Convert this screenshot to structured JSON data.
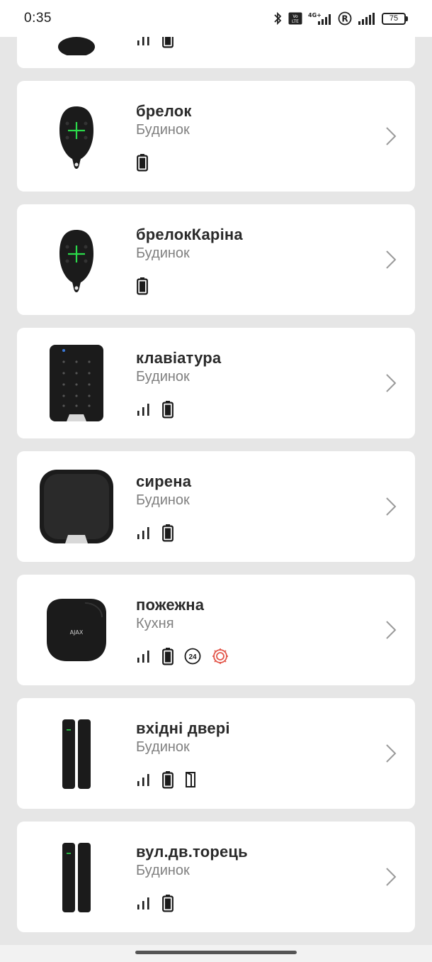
{
  "status_bar": {
    "time": "0:35",
    "battery_level": "75",
    "icons": [
      "bluetooth-icon",
      "volte-icon",
      "4g-signal-icon",
      "roaming-r-icon",
      "signal-icon",
      "battery-icon"
    ]
  },
  "devices": [
    {
      "name": "брелок",
      "room": "Будинок",
      "image": "keyfob",
      "status_icons": [
        "battery-icon"
      ]
    },
    {
      "name": "брелокКаріна",
      "room": "Будинок",
      "image": "keyfob",
      "status_icons": [
        "battery-icon"
      ]
    },
    {
      "name": "клавіатура",
      "room": "Будинок",
      "image": "keypad",
      "status_icons": [
        "signal-icon",
        "battery-icon"
      ]
    },
    {
      "name": "сирена",
      "room": "Будинок",
      "image": "siren",
      "status_icons": [
        "signal-icon",
        "battery-icon"
      ]
    },
    {
      "name": "пожежна",
      "room": "Кухня",
      "image": "fire-detector",
      "status_icons": [
        "signal-icon",
        "battery-icon",
        "24h-icon",
        "temperature-icon"
      ],
      "badge_24": "24"
    },
    {
      "name": "вхідні двері",
      "room": "Будинок",
      "image": "door-contact",
      "status_icons": [
        "signal-icon",
        "battery-icon",
        "door-open-icon"
      ]
    },
    {
      "name": "вул.дв.торець",
      "room": "Будинок",
      "image": "door-contact",
      "status_icons": [
        "signal-icon",
        "battery-icon"
      ]
    }
  ],
  "colors": {
    "background": "#e6e6e6",
    "card": "#ffffff",
    "device": "#1b1b1b",
    "led": "#2bd94a",
    "temperature_icon": "#e3574b"
  }
}
